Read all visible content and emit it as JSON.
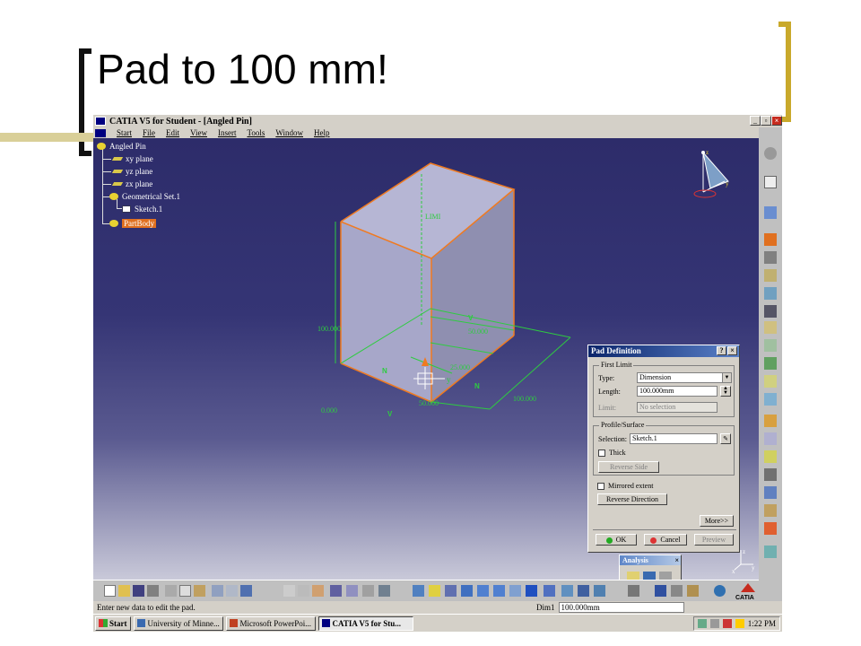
{
  "slide": {
    "title": "Pad to 100 mm!"
  },
  "window": {
    "title": "CATIA V5 for Student - [Angled Pin]"
  },
  "menu": [
    "Start",
    "File",
    "Edit",
    "View",
    "Insert",
    "Tools",
    "Window",
    "Help"
  ],
  "tree": {
    "root": "Angled Pin",
    "planes": [
      "xy plane",
      "yz plane",
      "zx plane"
    ],
    "set": "Geometrical Set.1",
    "sketch": "Sketch.1",
    "body": "PartBody"
  },
  "viewport": {
    "dim_height": "100.000",
    "dim_width_top": "50.000",
    "dim_mid": "25.000",
    "dim_depth": "100.000",
    "dim_bottom": "50.000",
    "dim_origin": "0.000",
    "limit_label": "LIMI",
    "axis_y": "y",
    "axis_z": "z",
    "axis_x": "x",
    "marker_n": "N",
    "marker_v": "V",
    "colors": {
      "part_edge": "#f07a20",
      "dimension": "#2ecc40"
    }
  },
  "dialog": {
    "title": "Pad Definition",
    "first_limit": "First Limit",
    "type_label": "Type:",
    "type_value": "Dimension",
    "length_label": "Length:",
    "length_value": "100.000mm",
    "limit_label": "Limit:",
    "limit_value": "No selection",
    "profile_surface": "Profile/Surface",
    "selection_label": "Selection:",
    "selection_value": "Sketch.1",
    "thick": "Thick",
    "reverse_side": "Reverse Side",
    "mirrored_extent": "Mirrored extent",
    "reverse_direction": "Reverse Direction",
    "more": "More>>",
    "ok": "OK",
    "cancel": "Cancel",
    "preview": "Preview"
  },
  "analysis": {
    "title": "Analysis"
  },
  "catia_logo": "CATIA",
  "status": {
    "message": "Enter new data to edit the pad.",
    "dim_label": "Dim1",
    "dim_value": "100.000mm"
  },
  "taskbar": {
    "start": "Start",
    "tasks": [
      "University of Minne...",
      "Microsoft PowerPoi...",
      "CATIA V5 for Stu..."
    ],
    "clock": "1:22 PM"
  }
}
